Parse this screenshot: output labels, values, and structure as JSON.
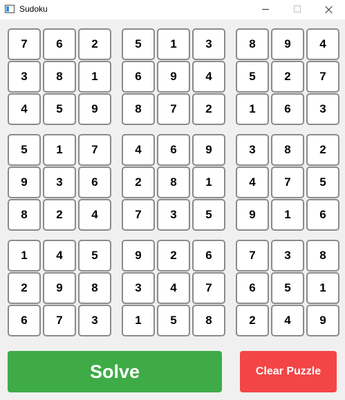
{
  "window": {
    "title": "Sudoku",
    "controls": [
      "minimize",
      "maximize",
      "close"
    ]
  },
  "board": {
    "rows": [
      [
        "7",
        "6",
        "2",
        "5",
        "1",
        "3",
        "8",
        "9",
        "4"
      ],
      [
        "3",
        "8",
        "1",
        "6",
        "9",
        "4",
        "5",
        "2",
        "7"
      ],
      [
        "4",
        "5",
        "9",
        "8",
        "7",
        "2",
        "1",
        "6",
        "3"
      ],
      [
        "5",
        "1",
        "7",
        "4",
        "6",
        "9",
        "3",
        "8",
        "2"
      ],
      [
        "9",
        "3",
        "6",
        "2",
        "8",
        "1",
        "4",
        "7",
        "5"
      ],
      [
        "8",
        "2",
        "4",
        "7",
        "3",
        "5",
        "9",
        "1",
        "6"
      ],
      [
        "1",
        "4",
        "5",
        "9",
        "2",
        "6",
        "7",
        "3",
        "8"
      ],
      [
        "2",
        "9",
        "8",
        "3",
        "4",
        "7",
        "6",
        "5",
        "1"
      ],
      [
        "6",
        "7",
        "3",
        "1",
        "5",
        "8",
        "2",
        "4",
        "9"
      ]
    ]
  },
  "buttons": {
    "solve_label": "Solve",
    "clear_label": "Clear Puzzle"
  },
  "colors": {
    "solve": "#3fab47",
    "clear": "#f44546",
    "cell_border": "#8a8a8a",
    "background": "#f0f0f0"
  }
}
